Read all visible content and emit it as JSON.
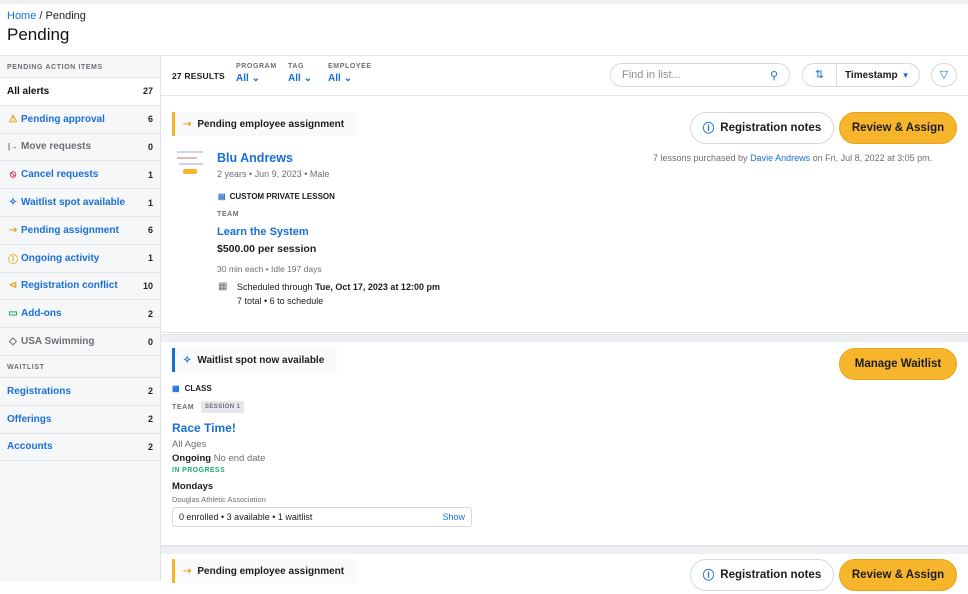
{
  "breadcrumb": {
    "home": "Home",
    "sep": "/",
    "current": "Pending"
  },
  "page_title": "Pending",
  "sidebar": {
    "section1": "PENDING ACTION ITEMS",
    "items": [
      {
        "label": "All alerts",
        "count": "27",
        "icon": ""
      },
      {
        "label": "Pending approval",
        "count": "6",
        "icon": "⚠"
      },
      {
        "label": "Move requests",
        "count": "0",
        "icon": "|→"
      },
      {
        "label": "Cancel requests",
        "count": "1",
        "icon": "⦸"
      },
      {
        "label": "Waitlist spot available",
        "count": "1",
        "icon": "✧"
      },
      {
        "label": "Pending assignment",
        "count": "6",
        "icon": "⇢"
      },
      {
        "label": "Ongoing activity",
        "count": "1",
        "icon": "ⓘ"
      },
      {
        "label": "Registration conflict",
        "count": "10",
        "icon": "⊲"
      },
      {
        "label": "Add-ons",
        "count": "2",
        "icon": "▭"
      },
      {
        "label": "USA Swimming",
        "count": "0",
        "icon": "◇"
      }
    ],
    "section2": "WAITLIST",
    "items2": [
      {
        "label": "Registrations",
        "count": "2"
      },
      {
        "label": "Offerings",
        "count": "2"
      },
      {
        "label": "Accounts",
        "count": "2"
      }
    ]
  },
  "filters": {
    "results": "27 RESULTS",
    "program_label": "PROGRAM",
    "program_value": "All",
    "tag_label": "TAG",
    "tag_value": "All",
    "employee_label": "EMPLOYEE",
    "employee_value": "All",
    "search_placeholder": "Find in list...",
    "sort_label": "Timestamp"
  },
  "card1": {
    "tag": "Pending employee assignment",
    "notes_btn": "Registration notes",
    "action_btn": "Review & Assign",
    "name": "Blu Andrews",
    "meta": "2 years • Jun 9, 2023 • Male",
    "purchased_pre": "7 lessons purchased by ",
    "purchased_by": "Davie Andrews",
    "purchased_post": " on Fri, Jul 8, 2022 at 3:05 pm.",
    "type": "CUSTOM PRIVATE LESSON",
    "team": "TEAM",
    "program": "Learn the System",
    "price": "$500.00 per session",
    "duration": "30 min each • Idle 197 days",
    "sched_pre": "Scheduled through ",
    "sched_date": "Tue, Oct 17, 2023 at 12:00 pm",
    "sched_sub": "7 total • 6 to schedule"
  },
  "card2": {
    "tag": "Waitlist spot now available",
    "action_btn": "Manage Waitlist",
    "type": "CLASS",
    "team": "TEAM",
    "session": "SESSION 1",
    "name": "Race Time!",
    "ages": "All Ages",
    "ongoing": "Ongoing",
    "end": "No end date",
    "status": "IN PROGRESS",
    "day": "Mondays",
    "org": "Douglas Athletic Association",
    "enroll": "0 enrolled • 3 available • 1 waitlist",
    "show": "Show"
  },
  "card3": {
    "tag": "Pending employee assignment",
    "notes_btn": "Registration notes",
    "action_btn": "Review & Assign"
  },
  "colors": {
    "accent": "#1a6fd6",
    "cta": "#f7b52c",
    "pending_tag": "#f7b52c",
    "waitlist_tag": "#1a6fd6",
    "status_green": "#1fae6b"
  }
}
